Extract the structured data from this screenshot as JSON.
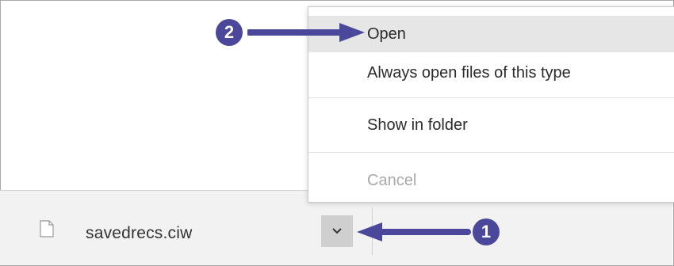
{
  "download": {
    "file_name": "savedrecs.ciw",
    "file_icon": "document-icon",
    "menu_toggle_icon": "chevron-down-icon"
  },
  "context_menu": {
    "items": [
      {
        "label": "Open",
        "state": "hovered"
      },
      {
        "label": "Always open files of this type",
        "state": "normal"
      },
      {
        "label": "Show in folder",
        "state": "normal"
      },
      {
        "label": "Cancel",
        "state": "disabled"
      }
    ]
  },
  "annotations": {
    "step1": "1",
    "step2": "2",
    "color": "#4b479a"
  }
}
